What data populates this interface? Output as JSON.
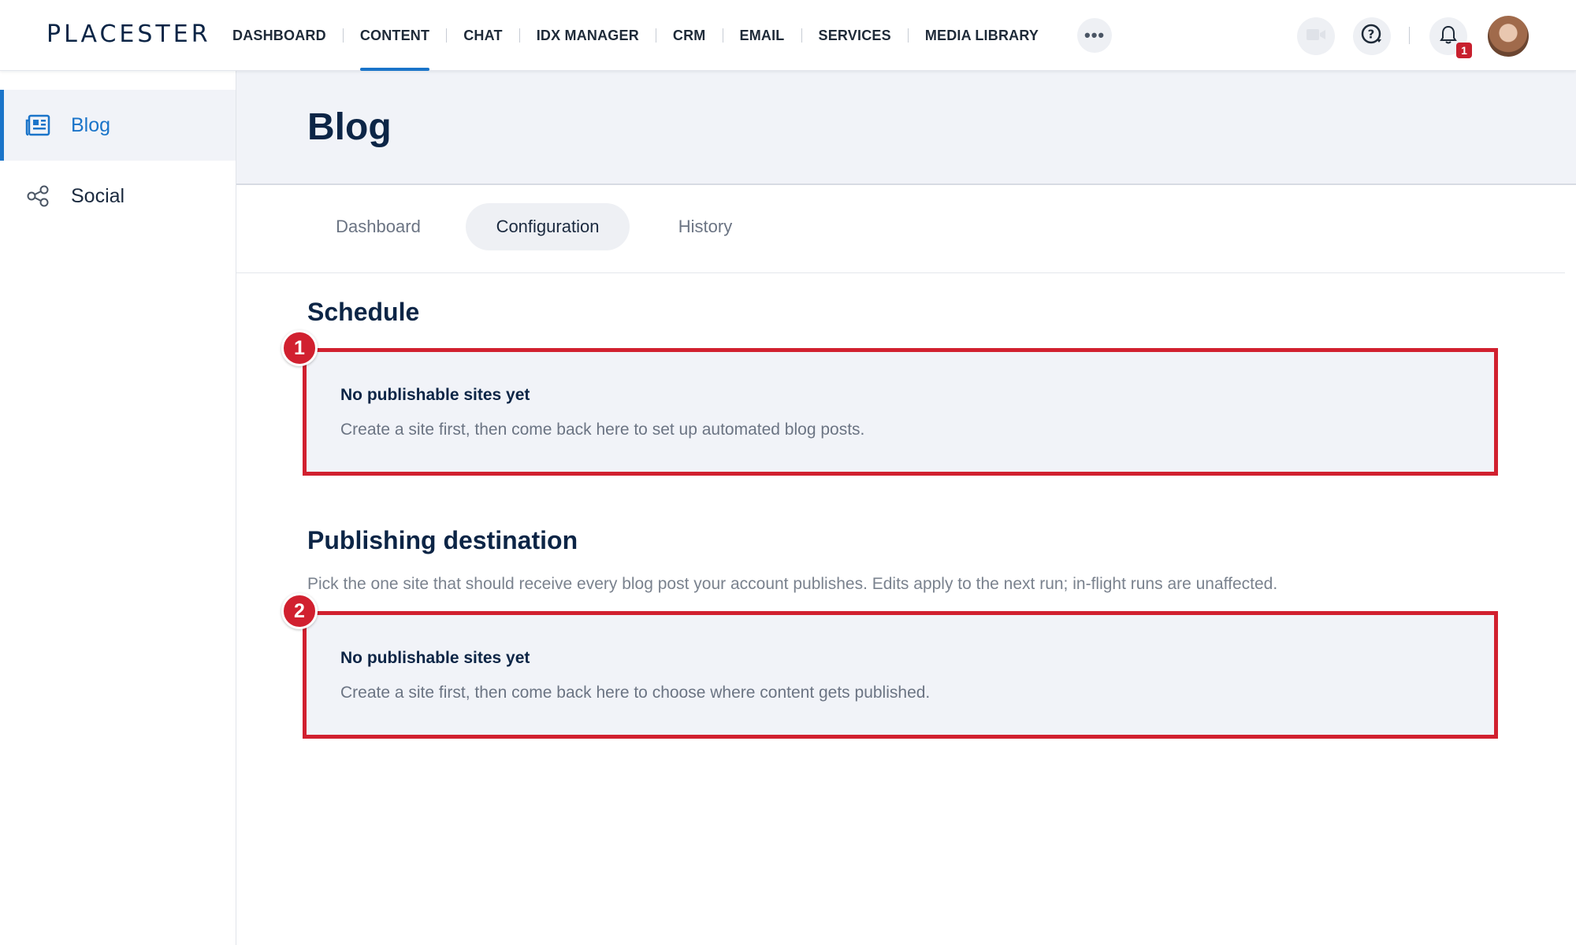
{
  "app": {
    "logo": "PLACESTER"
  },
  "nav": {
    "items": [
      {
        "label": "DASHBOARD"
      },
      {
        "label": "CONTENT",
        "active": true
      },
      {
        "label": "CHAT"
      },
      {
        "label": "IDX MANAGER"
      },
      {
        "label": "CRM"
      },
      {
        "label": "EMAIL"
      },
      {
        "label": "SERVICES"
      },
      {
        "label": "MEDIA LIBRARY"
      }
    ],
    "more_label": "•••",
    "notification_count": "1"
  },
  "sidebar": {
    "items": [
      {
        "label": "Blog",
        "icon": "newspaper-icon",
        "active": true
      },
      {
        "label": "Social",
        "icon": "share-icon"
      }
    ]
  },
  "page": {
    "title": "Blog",
    "tabs": [
      {
        "label": "Dashboard"
      },
      {
        "label": "Configuration",
        "active": true
      },
      {
        "label": "History"
      }
    ]
  },
  "schedule": {
    "title": "Schedule",
    "marker": "1",
    "empty_title": "No publishable sites yet",
    "empty_message": "Create a site first, then come back here to set up automated blog posts."
  },
  "destination": {
    "title": "Publishing destination",
    "description": "Pick the one site that should receive every blog post your account publishes. Edits apply to the next run; in-flight runs are unaffected.",
    "marker": "2",
    "empty_title": "No publishable sites yet",
    "empty_message": "Create a site first, then come back here to choose where content gets published."
  },
  "colors": {
    "accent": "#1a74c9",
    "highlight": "#d1202f",
    "heading": "#0c2546"
  }
}
